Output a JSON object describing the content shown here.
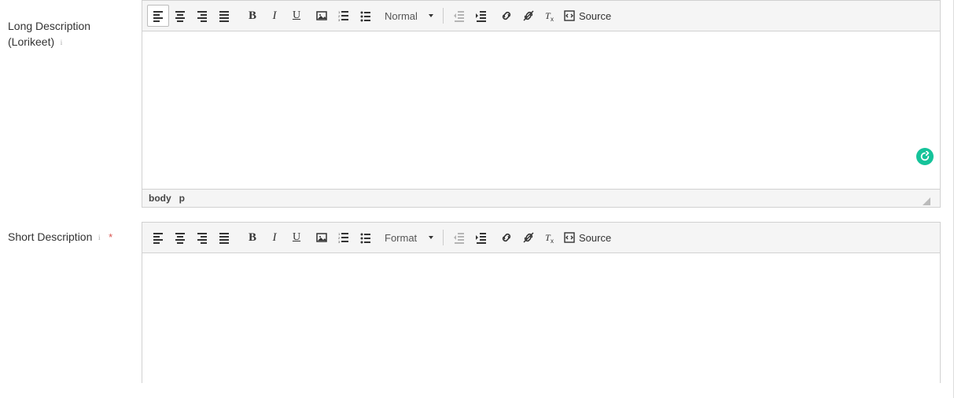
{
  "fields": {
    "long_desc": {
      "label_line1": "Long Description",
      "label_line2": "(Lorikeet)",
      "format_label": "Normal",
      "source_label": "Source",
      "footer_path1": "body",
      "footer_path2": "p"
    },
    "short_desc": {
      "label": "Short Description",
      "required": "*",
      "format_label": "Format",
      "source_label": "Source"
    }
  },
  "icons": {
    "align_left": "align-left-icon",
    "align_center": "align-center-icon",
    "align_right": "align-right-icon",
    "align_justify": "align-justify-icon",
    "bold": "B",
    "italic": "I",
    "underline": "U",
    "image": "image-icon",
    "numbered_list": "numbered-list-icon",
    "bullet_list": "bullet-list-icon",
    "outdent": "outdent-icon",
    "indent": "indent-icon",
    "link": "link-icon",
    "unlink": "unlink-icon",
    "remove_format": "remove-format-icon",
    "source": "source-icon"
  }
}
